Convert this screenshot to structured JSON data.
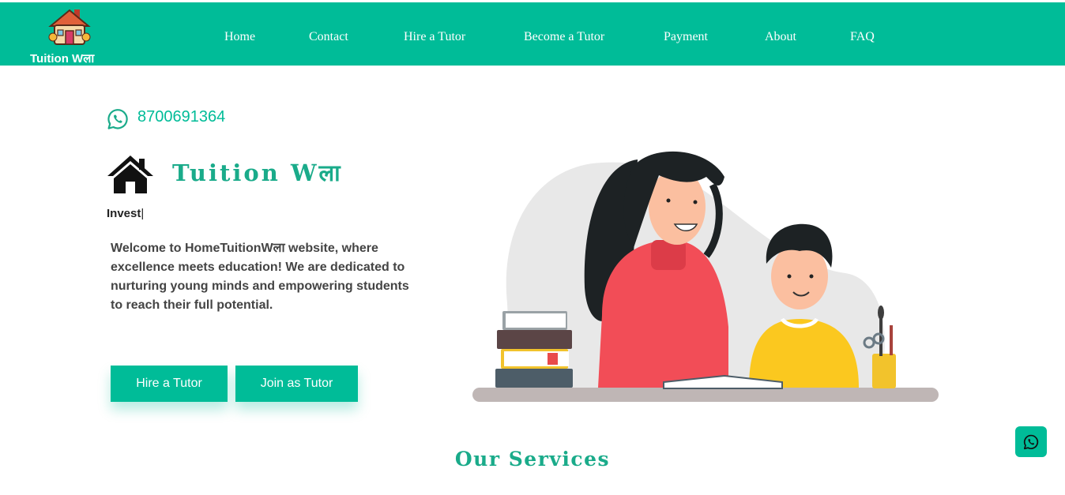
{
  "header": {
    "logo_text": "Tuition Wला",
    "nav": [
      {
        "label": "Home"
      },
      {
        "label": "Contact"
      },
      {
        "label": "Hire a Tutor"
      },
      {
        "label": "Become a Tutor"
      },
      {
        "label": "Payment"
      },
      {
        "label": "About"
      },
      {
        "label": "FAQ"
      }
    ]
  },
  "hero": {
    "phone": "8700691364",
    "brand_title": "Tuition Wला",
    "typed_text": "Invest",
    "typed_cursor": "|",
    "welcome": "Welcome to HomeTuitionWला website, where excellence meets education! We are dedicated to nurturing young minds and empowering students to reach their full potential.",
    "buttons": {
      "hire": "Hire a Tutor",
      "join": "Join as Tutor"
    }
  },
  "services": {
    "heading": "Our Services"
  },
  "colors": {
    "brand": "#00bc98",
    "heading": "#1aab8a"
  },
  "icons": {
    "logo": "house-logo-icon",
    "phone": "whatsapp-icon",
    "brand": "house-icon",
    "float": "whatsapp-icon"
  }
}
